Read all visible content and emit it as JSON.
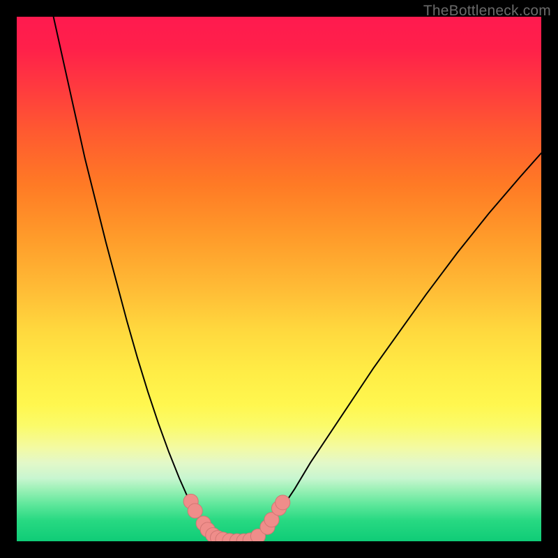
{
  "watermark": {
    "text": "TheBottleneck.com"
  },
  "colors": {
    "curve_stroke": "#000000",
    "marker_fill": "#ef8d8a",
    "marker_stroke": "#d17673",
    "frame": "#000000"
  },
  "chart_data": {
    "type": "line",
    "title": "",
    "xlabel": "",
    "ylabel": "",
    "xlim": [
      0,
      100
    ],
    "ylim": [
      0,
      100
    ],
    "grid": false,
    "legend": false,
    "series": [
      {
        "name": "left-branch",
        "x": [
          7,
          9,
          11,
          13,
          15,
          17,
          19,
          21,
          23,
          25,
          27,
          29,
          31,
          33,
          34.5,
          36,
          37,
          38
        ],
        "y": [
          100,
          91,
          82,
          73,
          65,
          57,
          49.5,
          42,
          35,
          28.5,
          22.5,
          17,
          12,
          7.5,
          4.8,
          2.5,
          1.2,
          0.6
        ]
      },
      {
        "name": "floor",
        "x": [
          38,
          40,
          42,
          44,
          46
        ],
        "y": [
          0.6,
          0.15,
          0.05,
          0.1,
          0.5
        ]
      },
      {
        "name": "right-branch",
        "x": [
          46,
          48,
          50,
          53,
          56,
          60,
          64,
          68,
          73,
          78,
          84,
          90,
          96,
          100
        ],
        "y": [
          0.5,
          2.5,
          5.5,
          10,
          15,
          21,
          27,
          33,
          40,
          47,
          55,
          62.5,
          69.5,
          74
        ]
      }
    ],
    "markers": [
      {
        "cluster": "left",
        "x": 33.2,
        "y": 7.6
      },
      {
        "cluster": "left",
        "x": 34.0,
        "y": 5.8
      },
      {
        "cluster": "left",
        "x": 35.6,
        "y": 3.4
      },
      {
        "cluster": "left",
        "x": 36.4,
        "y": 2.2
      },
      {
        "cluster": "left",
        "x": 37.4,
        "y": 1.2
      },
      {
        "cluster": "left",
        "x": 38.3,
        "y": 0.65
      },
      {
        "cluster": "left",
        "x": 39.3,
        "y": 0.35
      },
      {
        "cluster": "floor",
        "x": 40.6,
        "y": 0.1
      },
      {
        "cluster": "floor",
        "x": 42.0,
        "y": 0.05
      },
      {
        "cluster": "floor",
        "x": 43.3,
        "y": 0.05
      },
      {
        "cluster": "floor",
        "x": 44.5,
        "y": 0.2
      },
      {
        "cluster": "right",
        "x": 46.0,
        "y": 0.95
      },
      {
        "cluster": "right",
        "x": 47.8,
        "y": 2.7
      },
      {
        "cluster": "right",
        "x": 48.6,
        "y": 4.1
      },
      {
        "cluster": "right",
        "x": 50.0,
        "y": 6.3
      },
      {
        "cluster": "right",
        "x": 50.7,
        "y": 7.4
      }
    ],
    "marker_radius": 1.4
  }
}
